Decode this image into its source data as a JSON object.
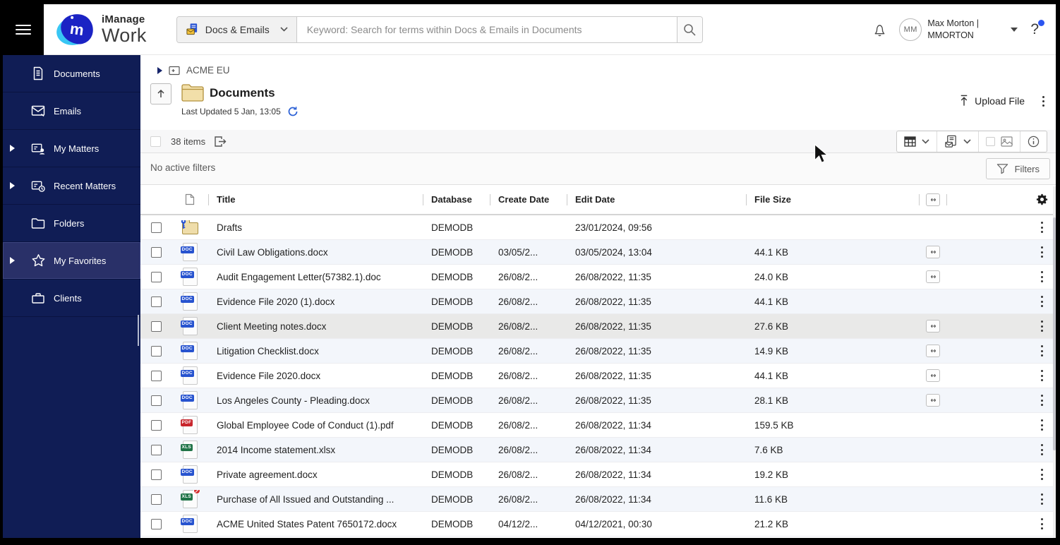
{
  "header": {
    "app_name_line1": "iManage",
    "app_name_line2": "Work",
    "logo_letter": "m",
    "scope": {
      "label": "Docs & Emails"
    },
    "search": {
      "placeholder": "Keyword: Search for terms within Docs & Emails in Documents"
    },
    "user": {
      "initials": "MM",
      "name": "Max Morton |",
      "id": "MMORTON"
    },
    "help_label": "?"
  },
  "sidebar": {
    "items": [
      {
        "label": "Documents",
        "icon": "documents",
        "expandable": false,
        "selected": false
      },
      {
        "label": "Emails",
        "icon": "emails",
        "expandable": false,
        "selected": false
      },
      {
        "label": "My Matters",
        "icon": "my-matters",
        "expandable": true,
        "selected": false
      },
      {
        "label": "Recent Matters",
        "icon": "recent-matters",
        "expandable": true,
        "selected": false
      },
      {
        "label": "Folders",
        "icon": "folders",
        "expandable": false,
        "selected": false
      },
      {
        "label": "My Favorites",
        "icon": "favorites",
        "expandable": true,
        "selected": true
      },
      {
        "label": "Clients",
        "icon": "clients",
        "expandable": false,
        "selected": false
      }
    ]
  },
  "breadcrumb": {
    "workspace": "ACME EU"
  },
  "folder_header": {
    "title": "Documents",
    "last_updated": "Last Updated 5 Jan, 13:05",
    "upload_label": "Upload File"
  },
  "items_bar": {
    "count_label": "38 items"
  },
  "filters_bar": {
    "status": "No active filters",
    "button_label": "Filters"
  },
  "table": {
    "columns": [
      "Title",
      "Database",
      "Create Date",
      "Edit Date",
      "File Size"
    ],
    "rows": [
      {
        "title": "Drafts",
        "icon": "folder",
        "icon_label": "",
        "restricted": false,
        "database": "DEMODB",
        "create_date": "",
        "edit_date": "23/01/2024, 09:56",
        "file_size": "",
        "linked": false,
        "highlighted": false
      },
      {
        "title": "Civil Law Obligations.docx",
        "icon": "doc",
        "icon_label": "DOC",
        "restricted": false,
        "database": "DEMODB",
        "create_date": "03/05/2...",
        "edit_date": "03/05/2024, 13:04",
        "file_size": "44.1 KB",
        "linked": true,
        "highlighted": false
      },
      {
        "title": "Audit Engagement Letter(57382.1).doc",
        "icon": "doc",
        "icon_label": "DOC",
        "restricted": false,
        "database": "DEMODB",
        "create_date": "26/08/2...",
        "edit_date": "26/08/2022, 11:35",
        "file_size": "24.0 KB",
        "linked": true,
        "highlighted": false
      },
      {
        "title": "Evidence File 2020 (1).docx",
        "icon": "doc",
        "icon_label": "DOC",
        "restricted": false,
        "database": "DEMODB",
        "create_date": "26/08/2...",
        "edit_date": "26/08/2022, 11:35",
        "file_size": "44.1 KB",
        "linked": false,
        "highlighted": false
      },
      {
        "title": "Client Meeting notes.docx",
        "icon": "doc",
        "icon_label": "DOC",
        "restricted": false,
        "database": "DEMODB",
        "create_date": "26/08/2...",
        "edit_date": "26/08/2022, 11:35",
        "file_size": "27.6 KB",
        "linked": true,
        "highlighted": true
      },
      {
        "title": "Litigation Checklist.docx",
        "icon": "doc",
        "icon_label": "DOC",
        "restricted": false,
        "database": "DEMODB",
        "create_date": "26/08/2...",
        "edit_date": "26/08/2022, 11:35",
        "file_size": "14.9 KB",
        "linked": true,
        "highlighted": false
      },
      {
        "title": "Evidence File 2020.docx",
        "icon": "doc",
        "icon_label": "DOC",
        "restricted": false,
        "database": "DEMODB",
        "create_date": "26/08/2...",
        "edit_date": "26/08/2022, 11:35",
        "file_size": "44.1 KB",
        "linked": true,
        "highlighted": false
      },
      {
        "title": "Los Angeles County - Pleading.docx",
        "icon": "doc",
        "icon_label": "DOC",
        "restricted": false,
        "database": "DEMODB",
        "create_date": "26/08/2...",
        "edit_date": "26/08/2022, 11:35",
        "file_size": "28.1 KB",
        "linked": true,
        "highlighted": false
      },
      {
        "title": "Global Employee Code of Conduct (1).pdf",
        "icon": "pdf",
        "icon_label": "PDF",
        "restricted": false,
        "database": "DEMODB",
        "create_date": "26/08/2...",
        "edit_date": "26/08/2022, 11:34",
        "file_size": "159.5 KB",
        "linked": false,
        "highlighted": false
      },
      {
        "title": "2014 Income statement.xlsx",
        "icon": "xls",
        "icon_label": "XLS",
        "restricted": false,
        "database": "DEMODB",
        "create_date": "26/08/2...",
        "edit_date": "26/08/2022, 11:34",
        "file_size": "7.6 KB",
        "linked": false,
        "highlighted": false
      },
      {
        "title": "Private agreement.docx",
        "icon": "doc",
        "icon_label": "DOC",
        "restricted": false,
        "database": "DEMODB",
        "create_date": "26/08/2...",
        "edit_date": "26/08/2022, 11:34",
        "file_size": "19.2 KB",
        "linked": false,
        "highlighted": false
      },
      {
        "title": "Purchase of All Issued and Outstanding ...",
        "icon": "xls",
        "icon_label": "XLS",
        "restricted": true,
        "database": "DEMODB",
        "create_date": "26/08/2...",
        "edit_date": "26/08/2022, 11:34",
        "file_size": "11.6 KB",
        "linked": false,
        "highlighted": false
      },
      {
        "title": "ACME United States Patent 7650172.docx",
        "icon": "doc",
        "icon_label": "DOC",
        "restricted": false,
        "database": "DEMODB",
        "create_date": "04/12/2...",
        "edit_date": "04/12/2021, 00:30",
        "file_size": "21.2 KB",
        "linked": false,
        "highlighted": false
      }
    ]
  },
  "colors": {
    "accent_blue": "#2f63d6",
    "sidebar_navy": "#101d55",
    "doc_blue": "#2753cf",
    "xls_green": "#207347",
    "pdf_red": "#c8252c",
    "alt_row": "#f3f6fb",
    "highlight_row": "#e9e9e8",
    "help_dot": "#2b55f0"
  }
}
